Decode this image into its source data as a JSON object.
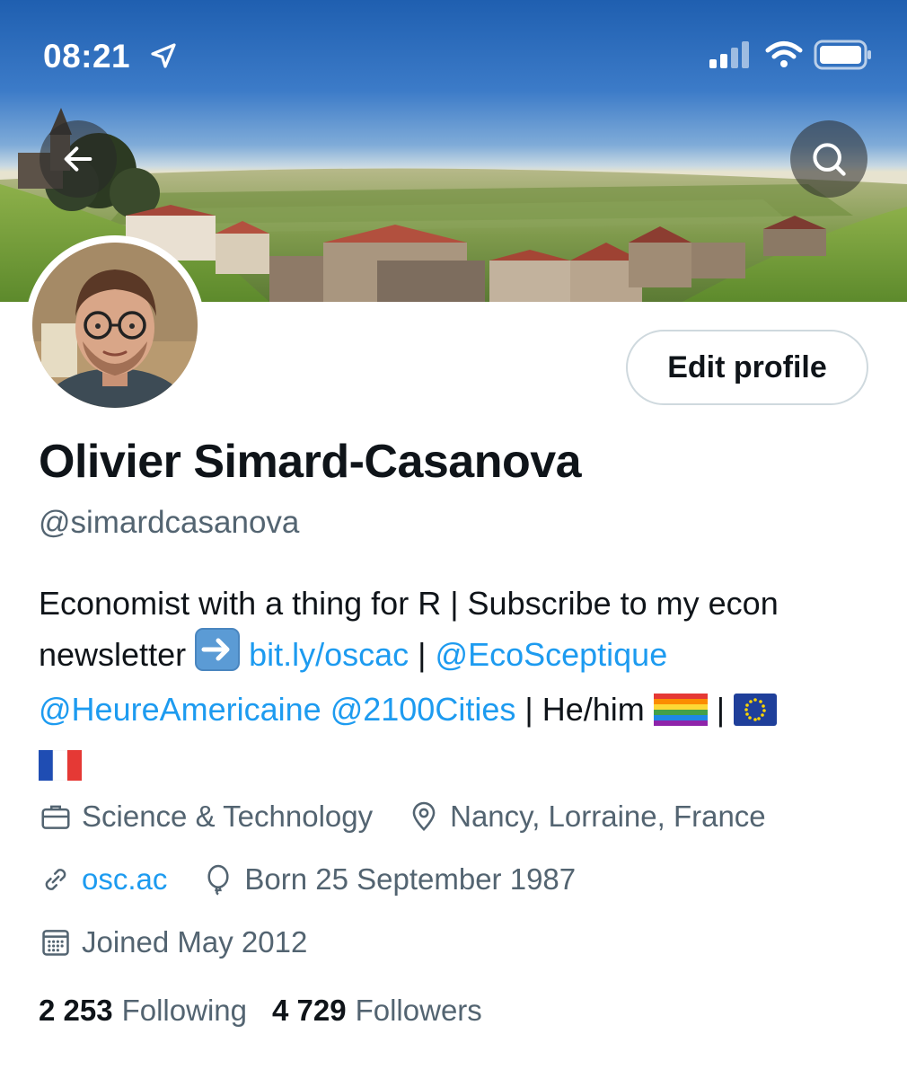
{
  "status_bar": {
    "time": "08:21"
  },
  "profile": {
    "edit_button_label": "Edit profile",
    "display_name": "Olivier Simard-Casanova",
    "handle": "@simardcasanova",
    "bio": {
      "text1": "Economist with a thing for R | Subscribe to my econ newsletter ",
      "link1": "bit.ly/oscac",
      "sep1": " | ",
      "mention1": "@EcoSceptique",
      "mention2": "@HeureAmericaine",
      "mention3": "@2100Cities",
      "text2": " | He/him ",
      "sep2": " | "
    },
    "category": "Science & Technology",
    "location": "Nancy, Lorraine, France",
    "website": "osc.ac",
    "birthday": "Born 25 September 1987",
    "joined": "Joined May 2012",
    "following_count": "2 253",
    "following_label": "Following",
    "followers_count": "4 729",
    "followers_label": "Followers"
  },
  "colors": {
    "link": "#1d9bf0",
    "secondary_text": "#536471",
    "primary_text": "#0f1419"
  }
}
